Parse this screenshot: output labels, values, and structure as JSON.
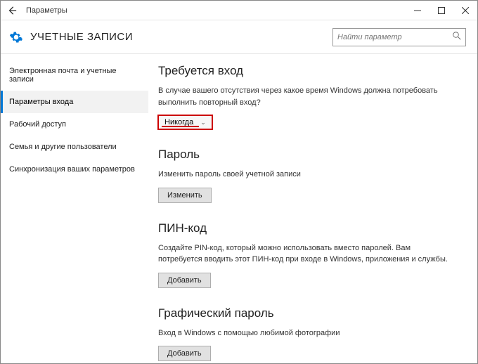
{
  "window": {
    "title": "Параметры"
  },
  "header": {
    "title": "УЧЕТНЫЕ ЗАПИСИ",
    "search_placeholder": "Найти параметр"
  },
  "sidebar": {
    "items": [
      {
        "label": "Электронная почта и учетные записи"
      },
      {
        "label": "Параметры входа"
      },
      {
        "label": "Рабочий доступ"
      },
      {
        "label": "Семья и другие пользователи"
      },
      {
        "label": "Синхронизация ваших параметров"
      }
    ],
    "active_index": 1
  },
  "sections": {
    "signin": {
      "title": "Требуется вход",
      "desc": "В случае вашего отсутствия через какое время Windows должна потребовать выполнить повторный вход?",
      "dropdown_value": "Никогда"
    },
    "password": {
      "title": "Пароль",
      "desc": "Изменить пароль своей учетной записи",
      "button": "Изменить"
    },
    "pin": {
      "title": "ПИН-код",
      "desc": "Создайте PIN-код, который можно использовать вместо паролей. Вам потребуется вводить этот ПИН-код при входе в Windows, приложения и службы.",
      "button": "Добавить"
    },
    "picture": {
      "title": "Графический пароль",
      "desc": "Вход в Windows с помощью любимой фотографии",
      "button": "Добавить"
    }
  }
}
